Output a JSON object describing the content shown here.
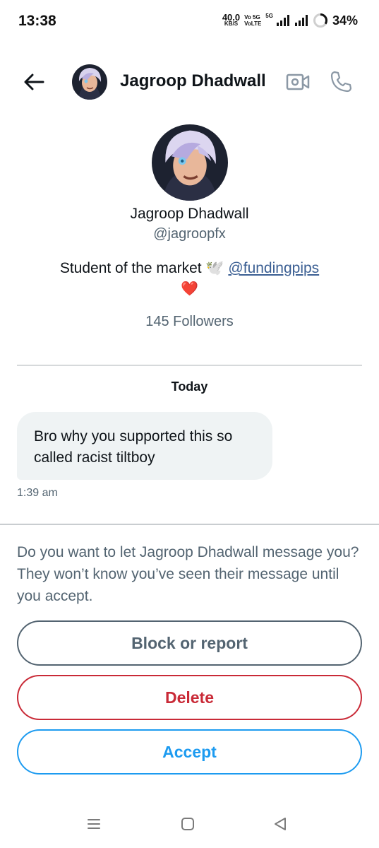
{
  "status_bar": {
    "time": "13:38",
    "net_speed": "40.0",
    "net_unit": "KB/S",
    "volte1": "Vo 5G",
    "volte2": "VoLTE",
    "five_g": "5G",
    "battery": "34%",
    "battery_level": 0.34
  },
  "header": {
    "name": "Jagroop Dhadwall",
    "icons": [
      "back-arrow-icon",
      "video-camera-icon",
      "phone-icon"
    ]
  },
  "profile": {
    "name": "Jagroop Dhadwall",
    "handle": "@jagroopfx",
    "bio_text": "Student of the market 🕊️ ",
    "bio_link": "@fundingpips",
    "bio_heart": "❤️",
    "followers": "145 Followers"
  },
  "conversation": {
    "day_label": "Today",
    "message": "Bro why you supported this so called racist tiltboy",
    "time": "1:39 am"
  },
  "request": {
    "prompt": "Do you want to let Jagroop Dhadwall message you? They won’t know you’ve seen their message until you accept.",
    "block_label": "Block or report",
    "delete_label": "Delete",
    "accept_label": "Accept"
  },
  "colors": {
    "accent": "#1d9bf0",
    "danger": "#c92a37",
    "muted": "#536471",
    "bubble": "#eff3f4"
  }
}
